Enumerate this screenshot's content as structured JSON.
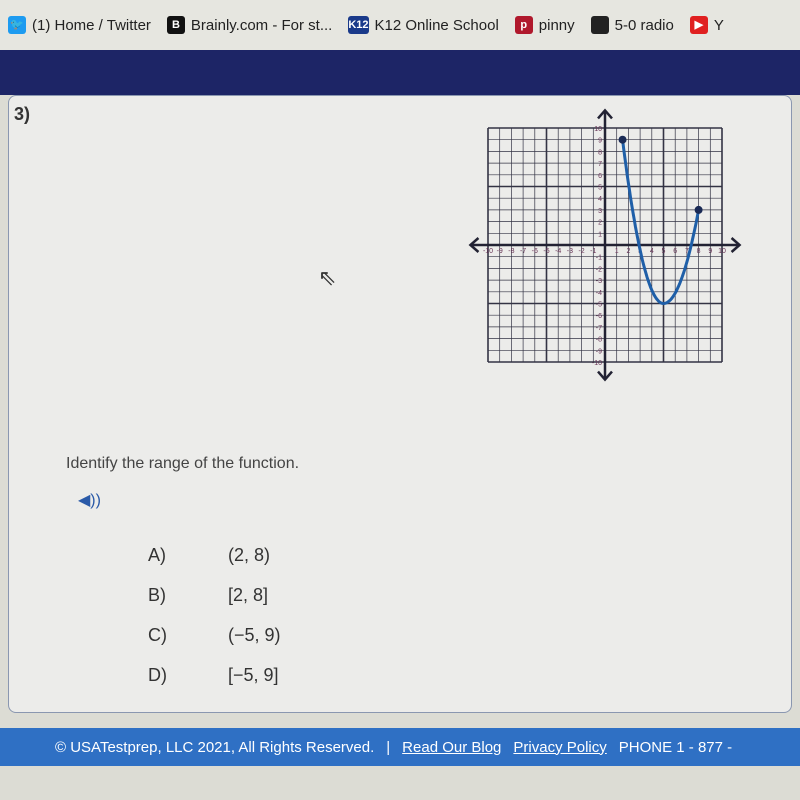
{
  "bookmarks": [
    {
      "label": "(1) Home / Twitter",
      "icon": "twitter-icon",
      "color": "#1d9bf0",
      "glyph": "🐦"
    },
    {
      "label": "Brainly.com - For st...",
      "icon": "brainly-icon",
      "color": "#111",
      "glyph": "B"
    },
    {
      "label": "K12 Online School",
      "icon": "k12-icon",
      "color": "#1a3a8a",
      "glyph": "K12"
    },
    {
      "label": "pinny",
      "icon": "pinterest-icon",
      "color": "#b0182c",
      "glyph": "p"
    },
    {
      "label": "5-0 radio",
      "icon": "radio-icon",
      "color": "#222",
      "glyph": ""
    },
    {
      "label": "Y",
      "icon": "youtube-icon",
      "color": "#e02020",
      "glyph": "▶"
    }
  ],
  "question": {
    "number": "3)",
    "prompt": "Identify the range of the function.",
    "speaker_icon": "speaker-icon",
    "speaker_glyph": "◀))"
  },
  "options": [
    {
      "letter": "A)",
      "value": "(2, 8)"
    },
    {
      "letter": "B)",
      "value": "[2, 8]"
    },
    {
      "letter": "C)",
      "value": "(−5, 9)"
    },
    {
      "letter": "D)",
      "value": "[−5, 9]"
    }
  ],
  "graph": {
    "xlim": [
      -10,
      10
    ],
    "ylim": [
      -10,
      10
    ],
    "curve_color": "#1f5fa8",
    "endpoints": [
      [
        1.5,
        9
      ],
      [
        8,
        3
      ]
    ],
    "vertex": [
      5,
      -5
    ],
    "x_ticks": [
      "-10",
      "-9",
      "-8",
      "-7",
      "-6",
      "-5",
      "-4",
      "-3",
      "-2",
      "-1",
      "1",
      "2",
      "3",
      "4",
      "5",
      "6",
      "7",
      "8",
      "9",
      "10"
    ],
    "y_ticks": [
      "10",
      "9",
      "8",
      "7",
      "6",
      "5",
      "4",
      "3",
      "2",
      "1",
      "-1",
      "-2",
      "-3",
      "-4",
      "-5",
      "-6",
      "-7",
      "-8",
      "-9",
      "-10"
    ]
  },
  "footer": {
    "copyright": "© USATestprep, LLC 2021, All Rights Reserved.",
    "separator": "|",
    "blog": "Read Our Blog",
    "privacy": "Privacy Policy",
    "phone": "PHONE 1 - 877 -"
  }
}
